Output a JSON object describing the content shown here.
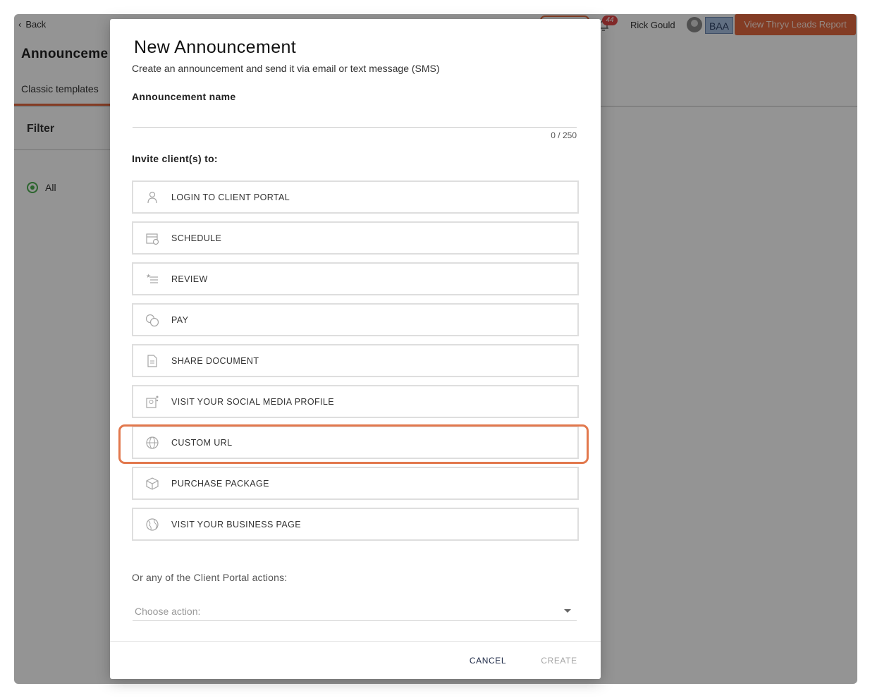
{
  "header": {
    "back_label": "Back",
    "notification_count": "44",
    "user_name": "Rick Gould",
    "badge": "BAA",
    "leads_report_label": "View Thryv Leads Report"
  },
  "page": {
    "title": "Announceme",
    "tab_classic": "Classic templates",
    "filter_title": "Filter",
    "filter_all": "All"
  },
  "modal": {
    "title": "New Announcement",
    "subtitle": "Create an announcement and send it via email or text message (SMS)",
    "name_label": "Announcement name",
    "name_value": "",
    "name_counter": "0 / 250",
    "invite_label": "Invite client(s) to:",
    "options": [
      {
        "label": "LOGIN TO CLIENT PORTAL",
        "icon": "user-portal-icon"
      },
      {
        "label": "SCHEDULE",
        "icon": "calendar-icon"
      },
      {
        "label": "REVIEW",
        "icon": "review-star-icon"
      },
      {
        "label": "PAY",
        "icon": "coins-icon"
      },
      {
        "label": "SHARE DOCUMENT",
        "icon": "document-icon"
      },
      {
        "label": "VISIT YOUR SOCIAL MEDIA PROFILE",
        "icon": "social-profile-icon"
      },
      {
        "label": "CUSTOM URL",
        "icon": "globe-icon"
      },
      {
        "label": "PURCHASE PACKAGE",
        "icon": "package-icon"
      },
      {
        "label": "VISIT YOUR BUSINESS PAGE",
        "icon": "business-globe-icon"
      }
    ],
    "portal_label": "Or any of the Client Portal actions:",
    "portal_placeholder": "Choose action:",
    "cancel_label": "CANCEL",
    "create_label": "CREATE"
  },
  "colors": {
    "accent": "#e2683e",
    "highlight": "#e2784d",
    "radio": "#4caf50"
  }
}
